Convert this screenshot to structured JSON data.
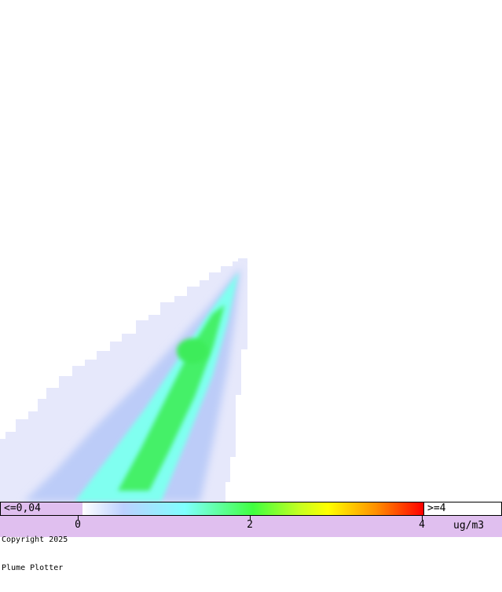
{
  "legend": {
    "min_label": "<=0,04",
    "max_label": ">=4",
    "ticks": [
      {
        "label": "0",
        "value": 0
      },
      {
        "label": "2",
        "value": 2
      },
      {
        "label": "4",
        "value": 4
      }
    ],
    "unit": "ug/m3",
    "scale_min": 0,
    "scale_max": 4,
    "colors": [
      "#ffffff",
      "#bcd0ff",
      "#7fffff",
      "#40ff40",
      "#c8ff20",
      "#ffff00",
      "#ff9000",
      "#ff0000"
    ],
    "min_color": "#e0bfef"
  },
  "footer": {
    "copyright_line1": "Copyright 2025",
    "copyright_line2": "Plume Plotter"
  },
  "plume": {
    "source_description_colors": {
      "outer_fringe": "#e4e6fb",
      "light_blue": "#b8ccf8",
      "cyan": "#80fff0",
      "green_core": "#40f060"
    }
  }
}
